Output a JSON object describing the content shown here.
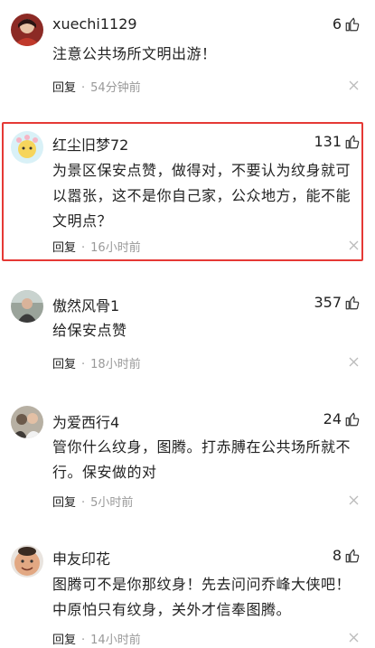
{
  "comments": [
    {
      "user": "xuechi1129",
      "likes": "6",
      "text": "注意公共场所文明出游！",
      "reply_label": "回复",
      "time": "54分钟前"
    },
    {
      "user": "红尘旧梦72",
      "likes": "131",
      "text": "为景区保安点赞，做得对，不要认为纹身就可以嚣张，这不是你自己家，公众地方，能不能文明点？",
      "reply_label": "回复",
      "time": "16小时前"
    },
    {
      "user": "傲然风骨1",
      "likes": "357",
      "text": "给保安点赞",
      "reply_label": "回复",
      "time": "18小时前"
    },
    {
      "user": "为爱西行4",
      "likes": "24",
      "text": "管你什么纹身，图腾。打赤膊在公共场所就不行。保安做的对",
      "reply_label": "回复",
      "time": "5小时前"
    },
    {
      "user": "申友印花",
      "likes": "8",
      "text": "图腾可不是你那纹身！先去问问乔峰大侠吧！中原怕只有纹身，关外才信奉图腾。",
      "reply_label": "回复",
      "time": "14小时前"
    }
  ],
  "separator": "·",
  "icons": {
    "like": "thumbs-up-icon",
    "dismiss": "close-icon"
  },
  "colors": {
    "highlight": "#e53935",
    "meta": "#999999",
    "text": "#222222"
  }
}
